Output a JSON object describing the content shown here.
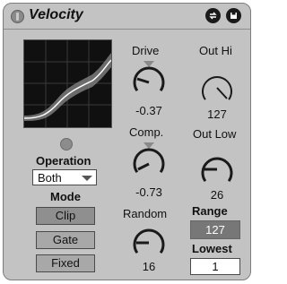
{
  "header": {
    "title": "Velocity"
  },
  "icons": {
    "activator": "device-power-icon",
    "hot_swap": "hot-swap-icon",
    "save": "save-preset-icon"
  },
  "operation": {
    "label": "Operation",
    "selected": "Both"
  },
  "mode": {
    "label": "Mode",
    "buttons": [
      "Clip",
      "Gate",
      "Fixed"
    ],
    "active": "Clip"
  },
  "drive": {
    "label": "Drive",
    "value": "-0.37"
  },
  "comp": {
    "label": "Comp.",
    "value": "-0.73"
  },
  "random": {
    "label": "Random",
    "value": "16"
  },
  "out_hi": {
    "label": "Out Hi",
    "value": "127"
  },
  "out_low": {
    "label": "Out Low",
    "value": "26"
  },
  "range": {
    "label": "Range",
    "value": "127"
  },
  "lowest": {
    "label": "Lowest",
    "value": "1"
  },
  "colors": {
    "panel": "#c3c3c3",
    "display_bg": "#101010",
    "grid": "#3a3a3a",
    "curve": "#e0e0e0",
    "range_bg": "#777777"
  }
}
